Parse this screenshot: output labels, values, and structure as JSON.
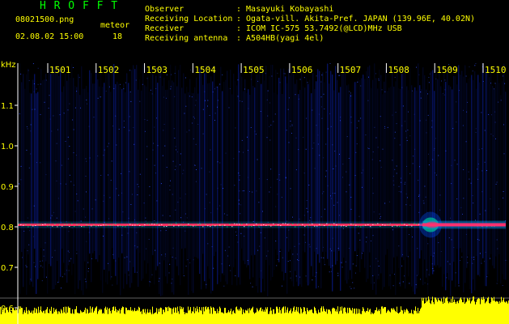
{
  "header": {
    "app_title": "H R O F F T",
    "filename": "08021500.png",
    "mode_label": "meteor",
    "datetime": "02.08.02 15:00",
    "count": "18",
    "info": [
      {
        "label": "Observer",
        "value": ": Masayuki Kobayashi"
      },
      {
        "label": "Receiving Location",
        "value": ": Ogata-vill. Akita-Pref. JAPAN (139.96E, 40.02N)"
      },
      {
        "label": "Receiver",
        "value": ": ICOM IC-575 53.7492(@LCD)MHz USB"
      },
      {
        "label": "Receiving antenna",
        "value": ": A504HB(yagi 4el)"
      }
    ]
  },
  "spectrogram": {
    "y_unit": "kHz",
    "y_ticks": [
      "1.1",
      "1.0",
      "0.9",
      "0.8",
      "0.7",
      "0.6"
    ],
    "y_tick_values": [
      1.1,
      1.0,
      0.9,
      0.8,
      0.7,
      0.6
    ],
    "x_ticks": [
      "1501",
      "1502",
      "1503",
      "1504",
      "1505",
      "1506",
      "1507",
      "1508",
      "1509",
      "1510"
    ],
    "carrier_freq_khz": 0.805,
    "colors": {
      "background": "#000000",
      "noise": "#0a1ea0",
      "carrier": "#ff3060",
      "level": "#ffff00",
      "axis": "#ffffff",
      "header_text": "#ffff00",
      "title": "#00ff00"
    }
  }
}
